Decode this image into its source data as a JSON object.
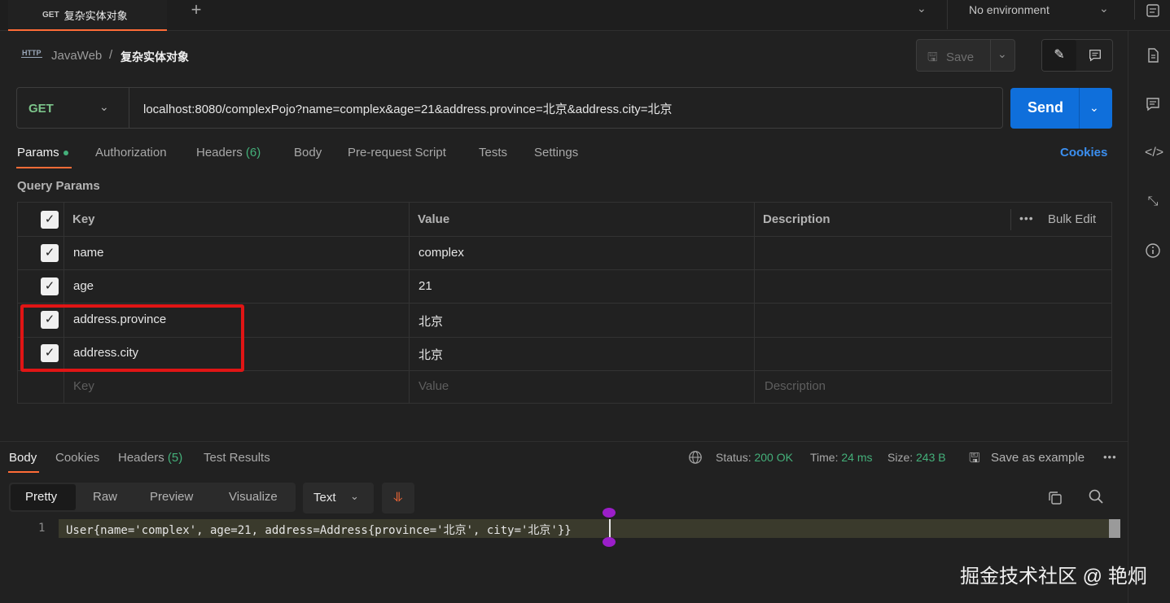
{
  "top_tab": {
    "method": "GET",
    "name": "复杂实体对象"
  },
  "new_tab": "+",
  "environment": {
    "label": "No environment"
  },
  "breadcrumb": {
    "icon": "HTTP",
    "collection": "JavaWeb",
    "separator": "/",
    "request": "复杂实体对象"
  },
  "toolbar": {
    "save_label": "Save"
  },
  "request": {
    "method": "GET",
    "url": "localhost:8080/complexPojo?name=complex&age=21&address.province=北京&address.city=北京",
    "send_label": "Send"
  },
  "request_tabs": [
    {
      "label": "Params",
      "active": true
    },
    {
      "label": "Authorization"
    },
    {
      "label": "Headers",
      "count": "(6)"
    },
    {
      "label": "Body"
    },
    {
      "label": "Pre-request Script"
    },
    {
      "label": "Tests"
    },
    {
      "label": "Settings"
    }
  ],
  "cookies_label": "Cookies",
  "query_params": {
    "title": "Query Params",
    "headers": {
      "key": "Key",
      "value": "Value",
      "description": "Description",
      "bulk_edit": "Bulk Edit"
    },
    "rows": [
      {
        "key": "name",
        "value": "complex",
        "checked": true
      },
      {
        "key": "age",
        "value": "21",
        "checked": true
      },
      {
        "key": "address.province",
        "value": "北京",
        "checked": true
      },
      {
        "key": "address.city",
        "value": "北京",
        "checked": true
      }
    ],
    "placeholders": {
      "key": "Key",
      "value": "Value",
      "description": "Description"
    }
  },
  "response": {
    "tabs": [
      {
        "label": "Body",
        "active": true
      },
      {
        "label": "Cookies"
      },
      {
        "label": "Headers",
        "count": "(5)"
      },
      {
        "label": "Test Results"
      }
    ],
    "status_label": "Status:",
    "status_value": "200 OK",
    "time_label": "Time:",
    "time_value": "24 ms",
    "size_label": "Size:",
    "size_value": "243 B",
    "save_example": "Save as example",
    "formats": [
      "Pretty",
      "Raw",
      "Preview",
      "Visualize"
    ],
    "content_type": "Text",
    "line_number": "1",
    "body": "User{name='complex', age=21, address=Address{province='北京', city='北京'}}"
  },
  "watermark": "掘金技术社区 @ 艳炯",
  "colors": {
    "accent": "#ff6c37",
    "send": "#0f6fdb",
    "success": "#44b07a",
    "highlight": "#e01515"
  }
}
